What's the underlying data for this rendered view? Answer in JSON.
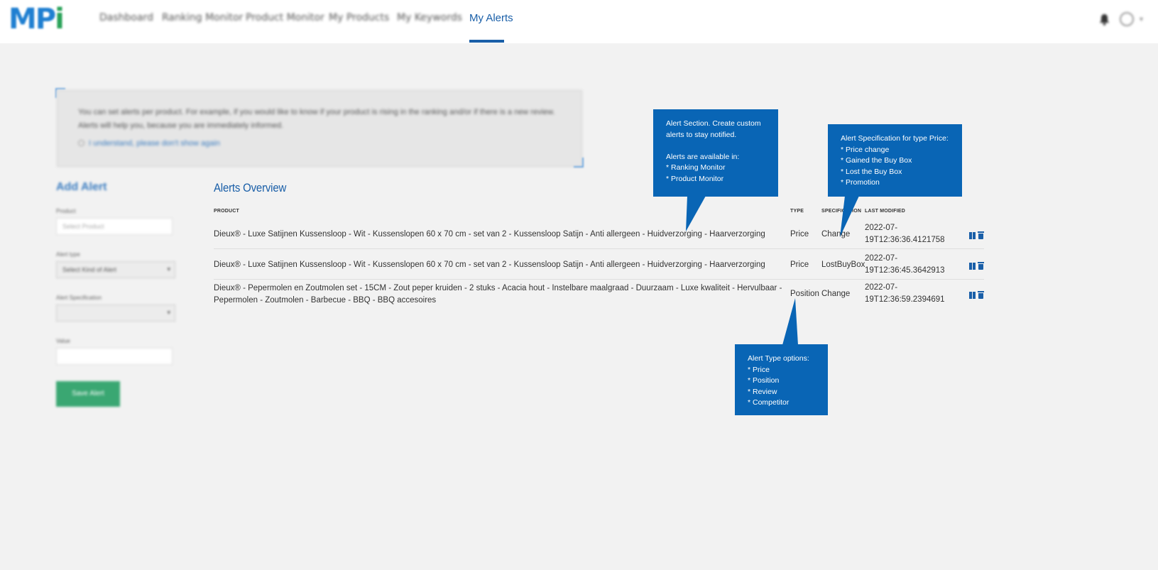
{
  "nav": {
    "logo_main": "MP",
    "logo_accent": "i",
    "items": [
      "Dashboard",
      "Ranking Monitor",
      "Product Monitor",
      "My Products",
      "My Keywords",
      "My Alerts"
    ],
    "active": "My Alerts"
  },
  "info": {
    "text": "You can set alerts per product. For example, if you would like to know if your product is rising in the ranking and/or if there is a new review. Alerts will help you, because you are immediately informed.",
    "checkbox_label": "I understand, please don't show again"
  },
  "form": {
    "title": "Add Alert",
    "product_label": "Product",
    "product_placeholder": "Select Product",
    "type_label": "Alert type",
    "type_value": "Select Kind of Alert",
    "spec_label": "Alert Specification",
    "spec_value": "",
    "value_label": "Value",
    "save_label": "Save Alert"
  },
  "overview": {
    "title": "Alerts Overview",
    "columns": {
      "product": "PRODUCT",
      "type": "TYPE",
      "spec": "SPECIFICATION",
      "modified": "LAST MODIFIED"
    },
    "rows": [
      {
        "product": "Dieux® - Luxe Satijnen Kussensloop - Wit - Kussenslopen 60 x 70 cm - set van 2 - Kussensloop Satijn - Anti allergeen - Huidverzorging - Haarverzorging",
        "type": "Price",
        "spec": "Change",
        "modified_1": "2022-07-",
        "modified_2": "19T12:36:36.4121758"
      },
      {
        "product": "Dieux® - Luxe Satijnen Kussensloop - Wit - Kussenslopen 60 x 70 cm - set van 2 - Kussensloop Satijn - Anti allergeen - Huidverzorging - Haarverzorging",
        "type": "Price",
        "spec": "LostBuyBox",
        "modified_1": "2022-07-",
        "modified_2": "19T12:36:45.3642913"
      },
      {
        "product_line1": "Dieux® - Pepermolen en Zoutmolen set - 15CM - Zout peper kruiden - 2 stuks - Acacia hout - Instelbare maalgraad - Duurzaam - Luxe kwaliteit - Hervulbaar -",
        "product_line2": "Pepermolen - Zoutmolen - Barbecue - BBQ - BBQ accesoires",
        "type": "Position",
        "spec": "Change",
        "modified_1": "2022-07-",
        "modified_2": "19T12:36:59.2394691"
      }
    ]
  },
  "callouts": {
    "alert_section": "Alert Section. Create custom\nalerts to stay notified.\n\nAlerts are available in:\n* Ranking Monitor\n* Product Monitor",
    "spec_price": "Alert Specification for type Price:\n* Price change\n* Gained the Buy Box\n* Lost the Buy Box\n* Promotion",
    "type_options": "Alert Type options:\n* Price\n* Position\n* Review\n* Competitor"
  },
  "colors": {
    "accent": "#1a5fa8",
    "callout": "#0965b5",
    "save": "#3aa772"
  }
}
